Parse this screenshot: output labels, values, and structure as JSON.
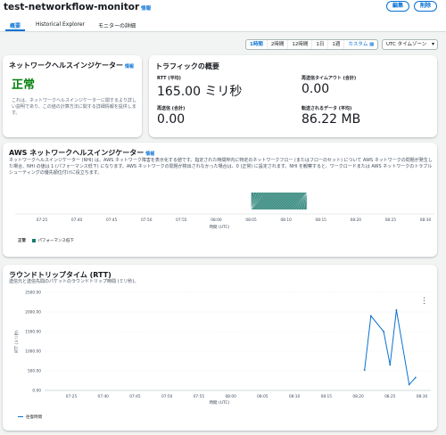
{
  "header": {
    "title": "test-networkflow-monitor",
    "info": "情報",
    "edit_button": "編集",
    "delete_button": "削除"
  },
  "tabs": [
    {
      "label": "概要",
      "active": true
    },
    {
      "label": "Historical Explorer",
      "active": false
    },
    {
      "label": "モニターの詳細",
      "active": false
    }
  ],
  "time_range": {
    "options": [
      "1時間",
      "2時間",
      "12時間",
      "1日",
      "1週"
    ],
    "selected": "1時間",
    "custom": "カスタム",
    "timezone": "UTC タイムゾーン"
  },
  "health_card": {
    "title": "ネットワークヘルスインジケーター",
    "info": "情報",
    "status": "正常",
    "description": "これは、ネットワークヘルスインジケーターに関するより詳しい説明であり、この値の計算方法に関する詳細情報を提供します。"
  },
  "traffic_card": {
    "title": "トラフィックの概要",
    "metrics": {
      "rtt_label": "RTT (平均)",
      "rtt_value": "165.00 ミリ秒",
      "timeout_label": "再送信タイムアウト (合計)",
      "timeout_value": "0.00",
      "retrans_label": "再送信 (合計)",
      "retrans_value": "0.00",
      "data_label": "転送されるデータ (平均)",
      "data_value": "86.22 MB"
    }
  },
  "nhi_card": {
    "title": "AWS ネットワークヘルスインジケーター",
    "info": "情報",
    "description": "ネットワークヘルスインジケーター (NHI) は、AWS ネットワーク障害を表示化する値です。指定された時間枠内に特定のネットワークフロー (またはフローのセット) について AWS ネットワークの問題が発生した場合、NHI の値は 1 (パフォーマンス低下) になります。AWS ネットワークの問題が検出されなかった場合は、0 (正常) に設定されます。NHI を観察すると、ワークロードまたは AWS ネットワークのトラブルシューティングの優先順位付けに役立ちます。",
    "legend_normal": "正常",
    "legend_degraded": "パフォーマンス低下",
    "x_label": "時間 (UTC)"
  },
  "rtt_card": {
    "title": "ラウンドトリップタイム (RTT)",
    "subtitle": "送信元と送信先間のパケットのラウンドトリップ時間 (ミリ秒)。",
    "legend": "往復時間",
    "menu_icon": "more-vertical-icon"
  },
  "chart_data": [
    {
      "type": "area",
      "title": "AWS ネットワークヘルスインジケーター",
      "xlabel": "時間 (UTC)",
      "ylabel": "",
      "x_ticks": [
        "07:25",
        "07:40",
        "07:45",
        "07:50",
        "07:55",
        "08:00",
        "08:05",
        "08:10",
        "08:15",
        "08:20",
        "08:25",
        "08:30"
      ],
      "series": [
        {
          "name": "パフォーマンス低下",
          "start": "08:05",
          "end": "08:13",
          "color": "#1b7a6e"
        }
      ]
    },
    {
      "type": "line",
      "title": "ラウンドトリップタイム (RTT)",
      "xlabel": "時間 (UTC)",
      "ylabel": "RTT (ミリ秒)",
      "ylim": [
        0,
        2500
      ],
      "y_ticks": [
        "2500.00",
        "2000.00",
        "1500.00",
        "1000.00",
        "500.00",
        "0.00"
      ],
      "x_ticks": [
        "07:25",
        "07:40",
        "07:45",
        "07:50",
        "07:55",
        "08:00",
        "08:05",
        "08:10",
        "08:15",
        "08:20",
        "08:25",
        "08:30"
      ],
      "series": [
        {
          "name": "往復時間",
          "color": "#0972d3",
          "points": [
            {
              "x": "08:21",
              "y": 520
            },
            {
              "x": "08:22",
              "y": 1900
            },
            {
              "x": "08:24",
              "y": 1500
            },
            {
              "x": "08:25",
              "y": 650
            },
            {
              "x": "08:26",
              "y": 2050
            },
            {
              "x": "08:28",
              "y": 150
            },
            {
              "x": "08:29",
              "y": 330
            }
          ]
        }
      ]
    }
  ]
}
